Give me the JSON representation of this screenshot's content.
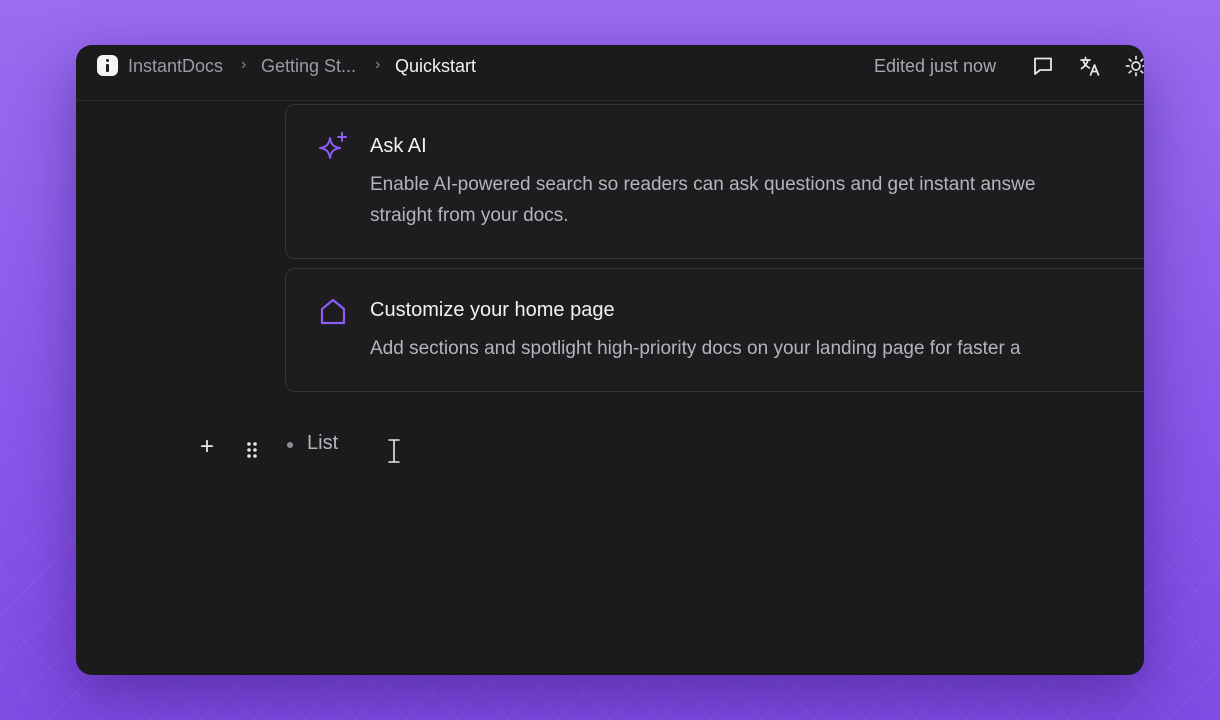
{
  "breadcrumb": [
    "InstantDocs",
    "Getting St...",
    "Quickstart"
  ],
  "status": {
    "edited": "Edited just now"
  },
  "toolbar_icons": [
    "comment-icon",
    "translate-icon",
    "sun-icon"
  ],
  "cards": [
    {
      "icon": "sparkle-icon",
      "title": "Ask AI",
      "desc_line1": "Enable AI-powered search so readers can ask questions and get instant answe",
      "desc_line2": "straight from your docs."
    },
    {
      "icon": "home-icon",
      "title": "Customize your home page",
      "desc_line1": "Add sections and spotlight high-priority docs on your landing page for faster a"
    }
  ],
  "block": {
    "add": "+",
    "list_text": "List"
  },
  "colors": {
    "accent": "#8b5cf6",
    "window_bg": "#1b1b1d",
    "page_bg": "#9a6cf0"
  }
}
